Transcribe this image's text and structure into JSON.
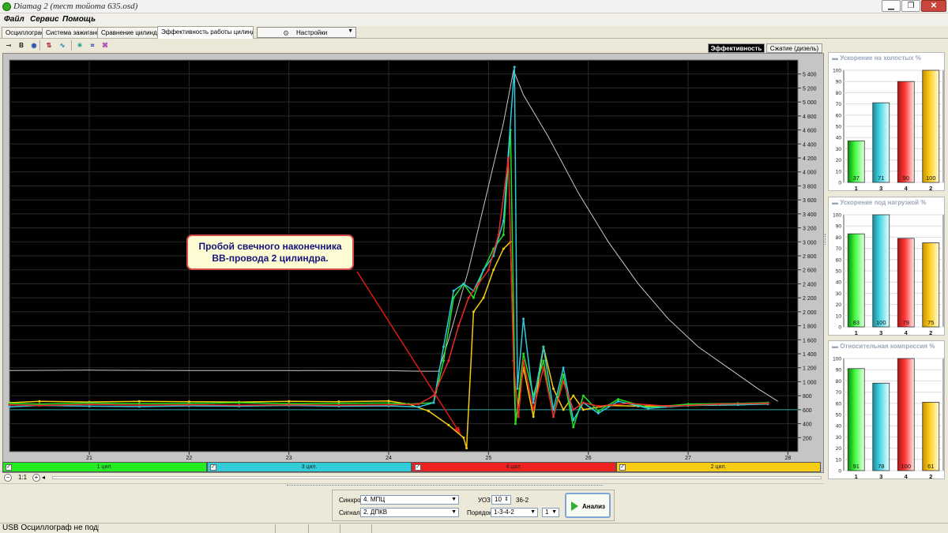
{
  "window": {
    "title": "Diamag 2 (тест тойота 635.osd)",
    "controls": {
      "minimize": "▁",
      "maximize": "❐",
      "close": "✕"
    }
  },
  "menu": [
    "Файл",
    "Сервис",
    "Помощь"
  ],
  "tabs": [
    {
      "label": "Осциллограф",
      "active": false
    },
    {
      "label": "Система зажигания",
      "active": false
    },
    {
      "label": "Сравнение цилиндров",
      "active": false
    },
    {
      "label": "Эффективность работы цилиндров",
      "active": true
    }
  ],
  "settings_dropdown": {
    "label": "Настройки"
  },
  "toolbar": {
    "tools": [
      {
        "icon": "cursor-tool-icon",
        "glyph": "⊸"
      },
      {
        "icon": "bold-tool-icon",
        "glyph": "B"
      },
      {
        "icon": "chip-tool-icon",
        "glyph": "◉"
      },
      {
        "icon": "scale-tool-icon",
        "glyph": "⇅"
      },
      {
        "icon": "trend-tool-icon",
        "glyph": "∿"
      },
      {
        "icon": "snowflake-tool-icon",
        "glyph": "✳"
      },
      {
        "icon": "network-tool-icon",
        "glyph": "⌗"
      },
      {
        "icon": "sync-tool-icon",
        "glyph": "⌘"
      }
    ]
  },
  "modes": {
    "efficiency": "Эффективность",
    "compression": "Сжатие (дизель)"
  },
  "callout": {
    "line1": "Пробой свечного наконечника",
    "line2": "ВВ-провода 2 цилиндра."
  },
  "chart_data": {
    "type": "line",
    "x_ticks": [
      "21",
      "22",
      "23",
      "24",
      "25",
      "26",
      "27",
      "28"
    ],
    "y_ticks": [
      "200",
      "400",
      "600",
      "800",
      "1 000",
      "1 200",
      "1 400",
      "1 600",
      "1 800",
      "2 000",
      "2 200",
      "2 400",
      "2 600",
      "2 800",
      "3 000",
      "3 200",
      "3 400",
      "3 600",
      "3 800",
      "4 000",
      "4 200",
      "4 400",
      "4 600",
      "4 800",
      "5 000",
      "5 200",
      "5 400"
    ],
    "xlim": [
      20.2,
      28.1
    ],
    "ylim": [
      0,
      5600
    ],
    "reference_line": 600,
    "series": [
      {
        "name": "1 цил.",
        "color": "#22e022",
        "points": [
          [
            20.2,
            690
          ],
          [
            20.5,
            680
          ],
          [
            21.0,
            695
          ],
          [
            21.5,
            685
          ],
          [
            22.0,
            690
          ],
          [
            22.5,
            700
          ],
          [
            23.0,
            685
          ],
          [
            23.5,
            690
          ],
          [
            24.0,
            695
          ],
          [
            24.2,
            680
          ],
          [
            24.45,
            700
          ],
          [
            24.55,
            1300
          ],
          [
            24.65,
            2200
          ],
          [
            24.75,
            2400
          ],
          [
            24.85,
            2200
          ],
          [
            24.95,
            2600
          ],
          [
            25.05,
            2900
          ],
          [
            25.15,
            3100
          ],
          [
            25.22,
            4600
          ],
          [
            25.27,
            400
          ],
          [
            25.35,
            1400
          ],
          [
            25.45,
            800
          ],
          [
            25.55,
            1300
          ],
          [
            25.65,
            500
          ],
          [
            25.75,
            1100
          ],
          [
            25.85,
            350
          ],
          [
            25.95,
            800
          ],
          [
            26.1,
            580
          ],
          [
            26.3,
            750
          ],
          [
            26.6,
            630
          ],
          [
            27.0,
            680
          ],
          [
            27.5,
            690
          ],
          [
            27.8,
            700
          ]
        ]
      },
      {
        "name": "3 цил.",
        "color": "#2ec8d8",
        "points": [
          [
            20.2,
            640
          ],
          [
            20.5,
            660
          ],
          [
            21.0,
            650
          ],
          [
            21.5,
            645
          ],
          [
            22.0,
            655
          ],
          [
            22.5,
            650
          ],
          [
            23.0,
            660
          ],
          [
            23.5,
            650
          ],
          [
            24.0,
            655
          ],
          [
            24.3,
            640
          ],
          [
            24.45,
            700
          ],
          [
            24.55,
            1500
          ],
          [
            24.65,
            2300
          ],
          [
            24.75,
            2400
          ],
          [
            24.85,
            2300
          ],
          [
            24.95,
            2600
          ],
          [
            25.05,
            2800
          ],
          [
            25.15,
            3300
          ],
          [
            25.26,
            5500
          ],
          [
            25.29,
            900
          ],
          [
            25.35,
            1900
          ],
          [
            25.45,
            700
          ],
          [
            25.55,
            1500
          ],
          [
            25.65,
            600
          ],
          [
            25.75,
            1200
          ],
          [
            25.85,
            450
          ],
          [
            25.95,
            700
          ],
          [
            26.1,
            550
          ],
          [
            26.3,
            720
          ],
          [
            26.6,
            620
          ],
          [
            27.0,
            660
          ],
          [
            27.5,
            670
          ],
          [
            27.8,
            680
          ]
        ]
      },
      {
        "name": "4 цил.",
        "color": "#ee2828",
        "points": [
          [
            20.2,
            670
          ],
          [
            20.5,
            660
          ],
          [
            21.0,
            675
          ],
          [
            21.5,
            665
          ],
          [
            22.0,
            670
          ],
          [
            22.5,
            665
          ],
          [
            23.0,
            670
          ],
          [
            23.5,
            665
          ],
          [
            24.0,
            670
          ],
          [
            24.3,
            680
          ],
          [
            24.45,
            800
          ],
          [
            24.6,
            1300
          ],
          [
            24.7,
            1800
          ],
          [
            24.8,
            2200
          ],
          [
            24.9,
            2400
          ],
          [
            25.0,
            2600
          ],
          [
            25.1,
            3100
          ],
          [
            25.2,
            4200
          ],
          [
            25.25,
            1300
          ],
          [
            25.3,
            500
          ],
          [
            25.35,
            1300
          ],
          [
            25.45,
            600
          ],
          [
            25.55,
            1200
          ],
          [
            25.65,
            500
          ],
          [
            25.75,
            1000
          ],
          [
            25.85,
            600
          ],
          [
            25.95,
            700
          ],
          [
            26.1,
            650
          ],
          [
            26.4,
            690
          ],
          [
            26.8,
            650
          ],
          [
            27.3,
            680
          ],
          [
            27.8,
            690
          ]
        ]
      },
      {
        "name": "2 цил.",
        "color": "#f5cc10",
        "points": [
          [
            20.2,
            700
          ],
          [
            20.5,
            720
          ],
          [
            21.0,
            710
          ],
          [
            21.5,
            720
          ],
          [
            22.0,
            715
          ],
          [
            22.5,
            710
          ],
          [
            23.0,
            720
          ],
          [
            23.5,
            715
          ],
          [
            24.0,
            725
          ],
          [
            24.2,
            680
          ],
          [
            24.4,
            580
          ],
          [
            24.6,
            380
          ],
          [
            24.75,
            200
          ],
          [
            24.78,
            50
          ],
          [
            24.85,
            2000
          ],
          [
            24.95,
            2200
          ],
          [
            25.05,
            2600
          ],
          [
            25.15,
            2900
          ],
          [
            25.22,
            3000
          ],
          [
            25.27,
            400
          ],
          [
            25.35,
            1200
          ],
          [
            25.45,
            500
          ],
          [
            25.55,
            1500
          ],
          [
            25.65,
            900
          ],
          [
            25.75,
            600
          ],
          [
            25.85,
            800
          ],
          [
            25.95,
            600
          ],
          [
            26.2,
            660
          ],
          [
            26.5,
            650
          ],
          [
            27.0,
            660
          ],
          [
            27.5,
            670
          ],
          [
            27.8,
            690
          ]
        ]
      },
      {
        "name": "",
        "color": "#c8c8c8",
        "points": [
          [
            20.2,
            1160
          ],
          [
            21.0,
            1165
          ],
          [
            22.0,
            1160
          ],
          [
            23.0,
            1160
          ],
          [
            24.0,
            1158
          ],
          [
            24.3,
            1150
          ],
          [
            24.5,
            1150
          ],
          [
            24.6,
            1600
          ],
          [
            24.8,
            2600
          ],
          [
            25.0,
            3800
          ],
          [
            25.15,
            4700
          ],
          [
            25.25,
            5450
          ],
          [
            25.35,
            5100
          ],
          [
            25.6,
            4500
          ],
          [
            25.9,
            3700
          ],
          [
            26.2,
            3000
          ],
          [
            26.5,
            2400
          ],
          [
            26.8,
            1900
          ],
          [
            27.1,
            1500
          ],
          [
            27.4,
            1200
          ],
          [
            27.7,
            900
          ],
          [
            27.9,
            720
          ]
        ]
      }
    ]
  },
  "cylinder_bar": [
    {
      "label": "1 цил.",
      "color": "#22ee22",
      "checked": true
    },
    {
      "label": "3 цил.",
      "color": "#32ccd8",
      "checked": true
    },
    {
      "label": "4 цил.",
      "color": "#ee2020",
      "checked": true
    },
    {
      "label": "2 цил.",
      "color": "#f7cc14",
      "checked": true
    }
  ],
  "zoom": {
    "minus": "−",
    "ratio": "1:1",
    "plus": "+",
    "arrow": "◂"
  },
  "controls": {
    "sync_label": "Синхро:",
    "sync_value": "4.  МПЦ",
    "signal_label": "Сигнал:",
    "signal_value": "2.  ДПКВ",
    "uoz_label": "УОЗ",
    "uoz_value": "10",
    "teeth": "36-2",
    "order_label": "Порядок",
    "order_value": "1-3-4-2",
    "order_extra": "1",
    "analyze_label": "Анализ"
  },
  "status": {
    "text": "USB Осциллограф не под"
  },
  "panels": [
    {
      "title": "Ускорение на холостых %",
      "cylinders": [
        "1",
        "3",
        "4",
        "2"
      ],
      "values": [
        37,
        71,
        90,
        100
      ],
      "yticks": [
        "0",
        "10",
        "20",
        "30",
        "40",
        "50",
        "60",
        "70",
        "80",
        "90",
        "100"
      ]
    },
    {
      "title": "Ускорение под нагрузкой %",
      "cylinders": [
        "1",
        "3",
        "4",
        "2"
      ],
      "values": [
        83,
        100,
        79,
        75
      ],
      "yticks": [
        "0",
        "10",
        "20",
        "30",
        "40",
        "50",
        "60",
        "70",
        "80",
        "90",
        "100"
      ]
    },
    {
      "title": "Относительная компрессия %",
      "cylinders": [
        "1",
        "3",
        "4",
        "2"
      ],
      "values": [
        91,
        78,
        100,
        61
      ],
      "yticks": [
        "0",
        "10",
        "20",
        "30",
        "40",
        "50",
        "60",
        "70",
        "80",
        "90",
        "100"
      ]
    }
  ],
  "colors": {
    "cyl1": "#22e022",
    "cyl3": "#2ec8d8",
    "cyl4": "#ee2828",
    "cyl2": "#f5cc10",
    "plot_bg": "#000000",
    "arrow": "#e01818"
  }
}
